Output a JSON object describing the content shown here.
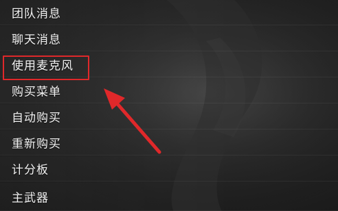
{
  "menu": {
    "items": [
      {
        "label": "团队消息"
      },
      {
        "label": "聊天消息"
      },
      {
        "label": "使用麦克风"
      },
      {
        "label": "购买菜单"
      },
      {
        "label": "自动购买"
      },
      {
        "label": "重新购买"
      },
      {
        "label": "计分板"
      },
      {
        "label": "主武器"
      }
    ]
  },
  "annotation": {
    "highlight_color": "#e0282a",
    "highlighted_item": "使用麦克风"
  }
}
